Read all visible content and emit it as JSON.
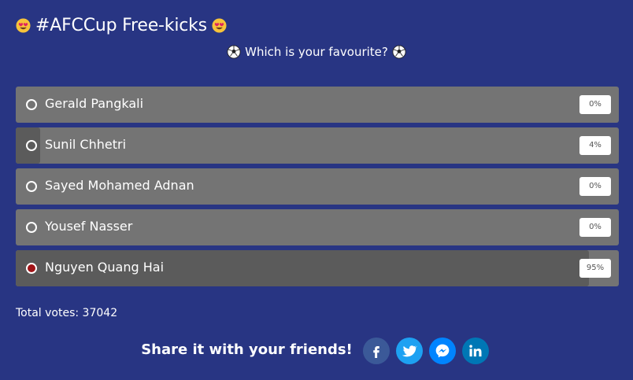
{
  "poll": {
    "title": "#AFCCup Free-kicks",
    "question": "Which is your favourite?",
    "options": [
      {
        "label": "Gerald Pangkali",
        "percent_text": "0%",
        "percent": 0,
        "selected": false
      },
      {
        "label": "Sunil Chhetri",
        "percent_text": "4%",
        "percent": 4,
        "selected": false
      },
      {
        "label": "Sayed Mohamed Adnan",
        "percent_text": "0%",
        "percent": 0,
        "selected": false
      },
      {
        "label": "Yousef Nasser",
        "percent_text": "0%",
        "percent": 0,
        "selected": false
      },
      {
        "label": "Nguyen Quang Hai",
        "percent_text": "95%",
        "percent": 95,
        "selected": true
      }
    ],
    "total_votes": "Total votes: 37042"
  },
  "share": {
    "text": "Share it with your friends!",
    "networks": [
      {
        "icon": "facebook-icon",
        "color": "#3b5998"
      },
      {
        "icon": "twitter-icon",
        "color": "#1da1f2"
      },
      {
        "icon": "messenger-icon",
        "color": "#0084ff"
      },
      {
        "icon": "linkedin-icon",
        "color": "#0077b5"
      }
    ]
  },
  "colors": {
    "background": "#283583",
    "bar": "#747474",
    "bar_fill": "#5b5b5b",
    "selected_radio": "#a01418"
  }
}
